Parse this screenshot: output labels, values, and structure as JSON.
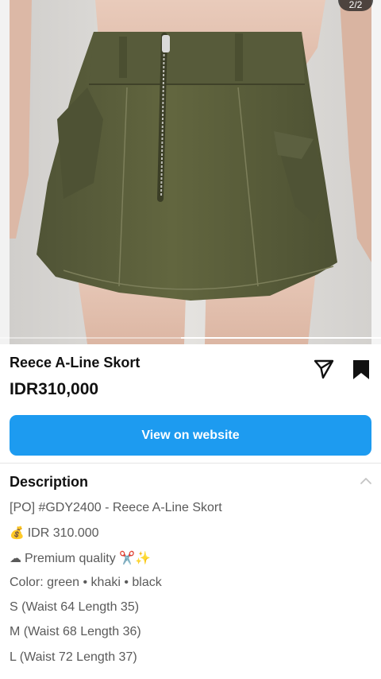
{
  "gallery": {
    "counter": "2/2",
    "position_fraction": 0.5
  },
  "product": {
    "title": "Reece A-Line Skort",
    "price": "IDR310,000"
  },
  "actions": {
    "share_icon": "paper-plane-icon",
    "save_icon": "bookmark-icon",
    "view_on_website": "View on website"
  },
  "description": {
    "heading": "Description",
    "collapse_icon": "chevron-up-icon",
    "lines": [
      {
        "emoji": "",
        "text": "[PO] #GDY2400 - Reece A-Line Skort"
      },
      {
        "emoji": "💰",
        "text": "IDR 310.000"
      },
      {
        "emoji": "☁",
        "text": "Premium quality ✂️✨"
      },
      {
        "emoji": "",
        "text": "Color: green • khaki • black"
      },
      {
        "emoji": "",
        "text": "S (Waist 64 Length 35)"
      },
      {
        "emoji": "",
        "text": "M (Waist 68 Length 36)"
      },
      {
        "emoji": "",
        "text": "L (Waist 72 Length 37)"
      }
    ]
  },
  "colors": {
    "accent": "#1d9bf0",
    "skirt": "#5a5e3f",
    "background": "#ffffff"
  }
}
